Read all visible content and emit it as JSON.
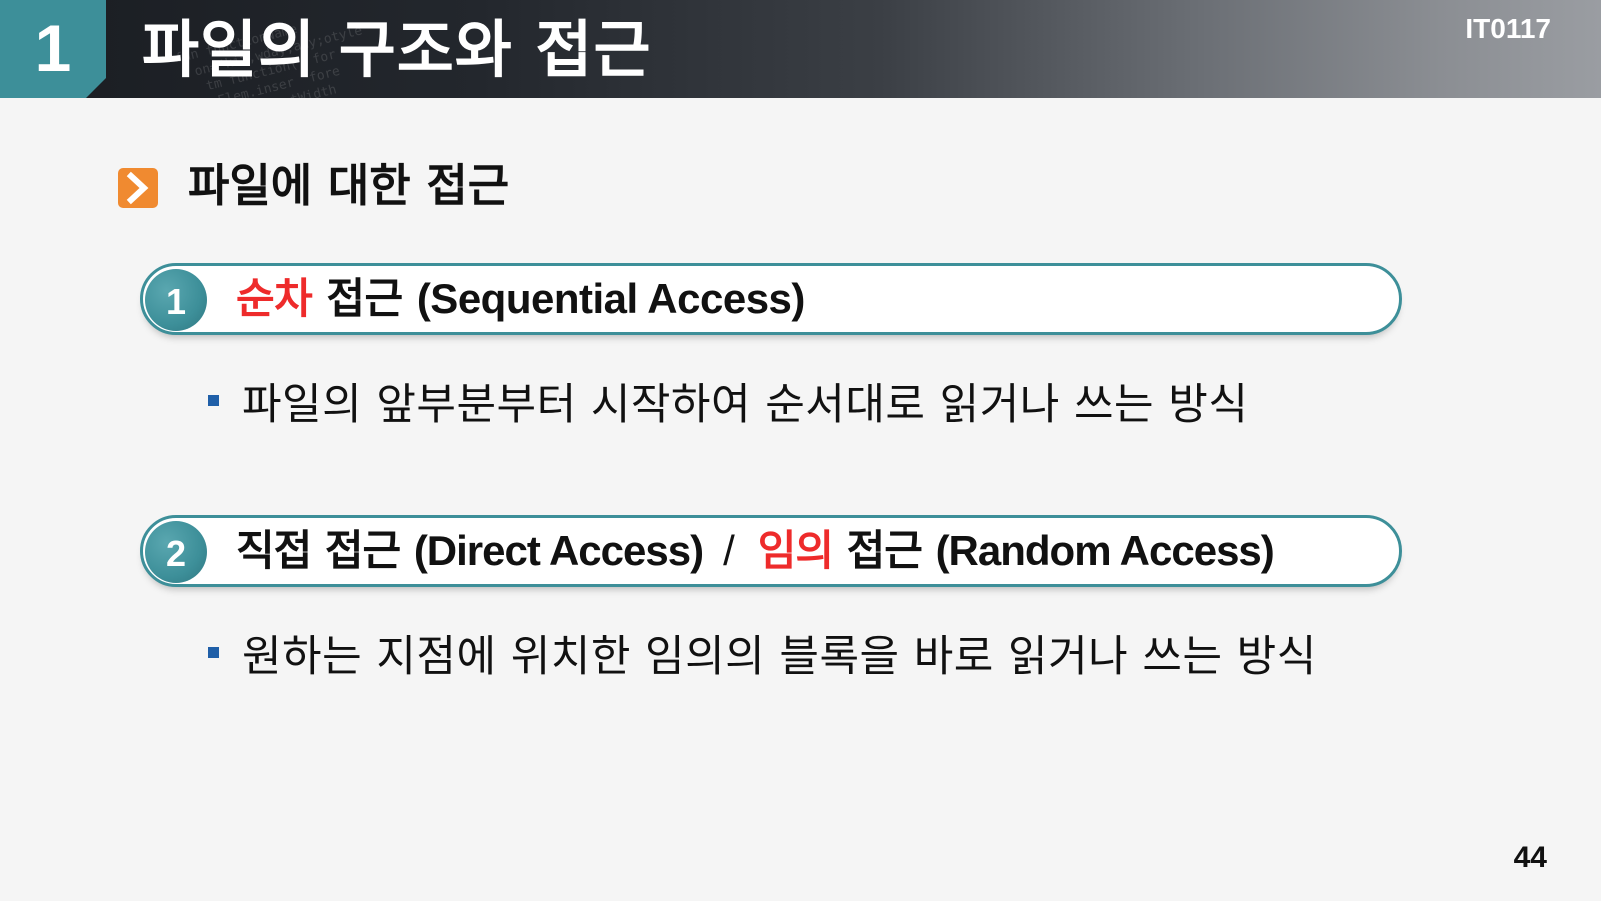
{
  "header": {
    "section_number": "1",
    "title": "파일의 구조와 접근",
    "course_code": "IT0117"
  },
  "heading": {
    "icon": "chevron-right-icon",
    "text": "파일에 대한 접근"
  },
  "items": [
    {
      "number": "1",
      "highlight": "순차",
      "rest": " 접근 ",
      "english": "(Sequential Access)",
      "bullet": "파일의 앞부분부터 시작하여 순서대로 읽거나 쓰는 방식"
    },
    {
      "number": "2",
      "part1": "직접 접근 ",
      "english1": "(Direct Access)",
      "separator": "/",
      "highlight": "임의",
      "rest": " 접근 ",
      "english2": "(Random Access)",
      "bullet": "원하는 지점에 위치한 임의의 블록을 바로 읽거나 쓰는 방식"
    }
  ],
  "page_number": "44",
  "colors": {
    "accent": "#3d8f99",
    "highlight": "#ee2b2b",
    "heading_icon": "#f08a30",
    "bullet": "#1f5fa8"
  }
}
